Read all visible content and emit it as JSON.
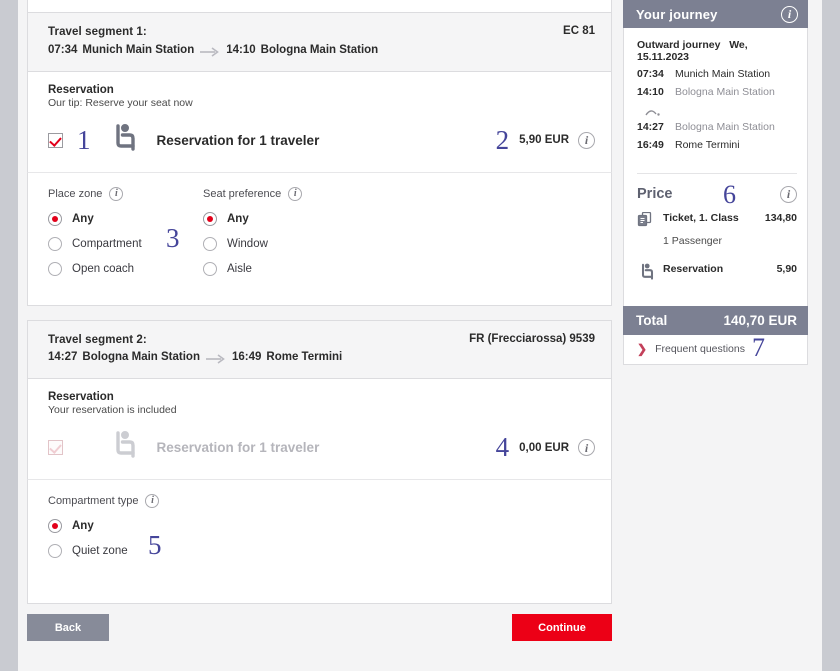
{
  "segments": [
    {
      "title": "Travel segment 1:",
      "dep_time": "07:34",
      "dep_station": "Munich Main Station",
      "arr_time": "14:10",
      "arr_station": "Bologna Main Station",
      "train": "EC 81",
      "reservation": {
        "title": "Reservation",
        "subtitle": "Our tip: Reserve your seat now",
        "checked": true,
        "label": "Reservation for 1 traveler",
        "price": "5,90 EUR",
        "annot_checkbox": "1",
        "annot_price": "2"
      },
      "options": {
        "annot": "3",
        "groups": [
          {
            "label": "Place zone",
            "choices": [
              {
                "label": "Any",
                "selected": true
              },
              {
                "label": "Compartment",
                "selected": false
              },
              {
                "label": "Open coach",
                "selected": false
              }
            ]
          },
          {
            "label": "Seat preference",
            "choices": [
              {
                "label": "Any",
                "selected": true
              },
              {
                "label": "Window",
                "selected": false
              },
              {
                "label": "Aisle",
                "selected": false
              }
            ]
          }
        ]
      }
    },
    {
      "title": "Travel segment 2:",
      "dep_time": "14:27",
      "dep_station": "Bologna Main Station",
      "arr_time": "16:49",
      "arr_station": "Rome Termini",
      "train": "FR (Frecciarossa) 9539",
      "reservation": {
        "title": "Reservation",
        "subtitle": "Your reservation is included",
        "checked": true,
        "disabled": true,
        "label": "Reservation for 1 traveler",
        "price": "0,00 EUR",
        "annot_price": "4"
      },
      "options": {
        "annot": "5",
        "groups": [
          {
            "label": "Compartment type",
            "choices": [
              {
                "label": "Any",
                "selected": true
              },
              {
                "label": "Quiet zone",
                "selected": false
              }
            ]
          }
        ]
      }
    }
  ],
  "sidebar": {
    "journey": {
      "header": "Your journey",
      "direction_label": "Outward journey",
      "date": "We, 15.11.2023",
      "legs": [
        {
          "time": "07:34",
          "station": "Munich Main Station",
          "muted": false
        },
        {
          "time": "14:10",
          "station": "Bologna Main Station",
          "muted": true
        },
        {
          "time": "14:27",
          "station": "Bologna Main Station",
          "muted": true
        },
        {
          "time": "16:49",
          "station": "Rome Termini",
          "muted": false
        }
      ]
    },
    "price": {
      "title": "Price",
      "annot": "6",
      "items": [
        {
          "label": "Ticket, 1. Class",
          "value": "134,80",
          "sub": "1 Passenger",
          "icon": "ticket-icon"
        },
        {
          "label": "Reservation",
          "value": "5,90",
          "sub": "",
          "icon": "seat-icon"
        }
      ],
      "total_label": "Total",
      "total_value": "140,70 EUR"
    },
    "faq": {
      "label": "Frequent questions",
      "annot": "7"
    }
  },
  "footer": {
    "back_label": "Back",
    "continue_label": "Continue"
  },
  "colors": {
    "accent_red": "#ec0016",
    "panel_grey": "#7c8092",
    "annotation_blue": "#45459a"
  }
}
